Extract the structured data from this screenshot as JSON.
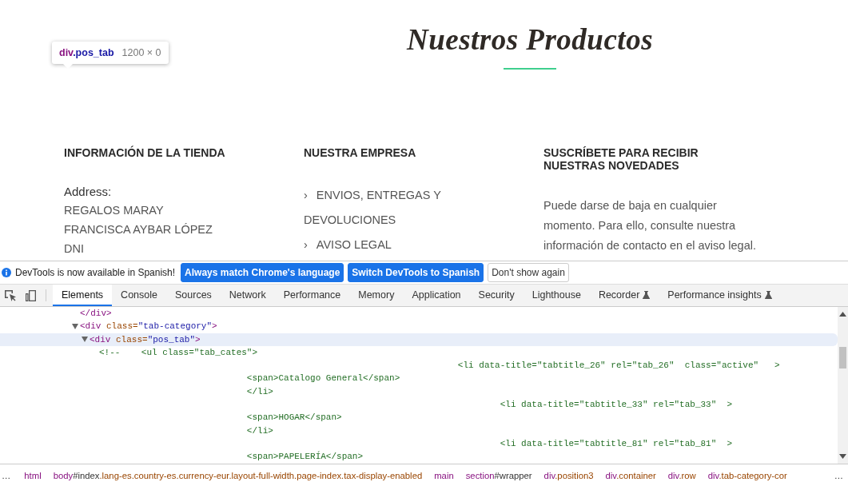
{
  "page": {
    "title": "Nuestros Productos",
    "tooltip": {
      "tokens": [
        {
          "kind": "tag",
          "text": "div"
        },
        {
          "kind": "class",
          "text": ".pos_tab"
        }
      ],
      "size": "1200 × 0"
    },
    "columns": [
      {
        "kind": "info",
        "heading": "INFORMACIÓN DE LA TIENDA",
        "label": "Address:",
        "lines": [
          "REGALOS MARAY",
          "FRANCISCA AYBAR LÓPEZ",
          "DNI"
        ]
      },
      {
        "kind": "links",
        "heading": "NUESTRA EMPRESA",
        "links": [
          {
            "bullet": "›",
            "text": "ENVIOS, ENTREGAS Y DEVOLUCIONES"
          },
          {
            "bullet": "›",
            "text": "AVISO LEGAL"
          }
        ]
      },
      {
        "kind": "text",
        "heading": "SUSCRÍBETE PARA RECIBIR NUESTRAS NOVEDADES",
        "paragraph": "Puede darse de baja en cualquier momento. Para ello, consulte nuestra información de contacto en el aviso legal."
      }
    ]
  },
  "devtools": {
    "infobar": {
      "message": "DevTools is now available in Spanish!",
      "buttons": [
        {
          "label": "Always match Chrome's language",
          "primary": true
        },
        {
          "label": "Switch DevTools to Spanish",
          "primary": true
        },
        {
          "label": "Don't show again",
          "primary": false
        }
      ]
    },
    "tabs": [
      {
        "label": "Elements",
        "selected": true,
        "experimental": false
      },
      {
        "label": "Console",
        "selected": false,
        "experimental": false
      },
      {
        "label": "Sources",
        "selected": false,
        "experimental": false
      },
      {
        "label": "Network",
        "selected": false,
        "experimental": false
      },
      {
        "label": "Performance",
        "selected": false,
        "experimental": false
      },
      {
        "label": "Memory",
        "selected": false,
        "experimental": false
      },
      {
        "label": "Application",
        "selected": false,
        "experimental": false
      },
      {
        "label": "Security",
        "selected": false,
        "experimental": false
      },
      {
        "label": "Lighthouse",
        "selected": false,
        "experimental": false
      },
      {
        "label": "Recorder",
        "selected": false,
        "experimental": true
      },
      {
        "label": "Performance insights",
        "selected": false,
        "experimental": true
      }
    ],
    "dom_tree": [
      {
        "tokens": [
          {
            "kind": "tag",
            "text": "</div>"
          }
        ],
        "selected": false
      },
      {
        "tokens": [
          {
            "kind": "tag",
            "text": "<div"
          },
          {
            "kind": "attr",
            "text": " class="
          },
          {
            "kind": "value",
            "text": "\"tab-category\""
          },
          {
            "kind": "tag",
            "text": ">"
          }
        ],
        "selected": false,
        "expanded": true,
        "children": [
          {
            "tokens": [
              {
                "kind": "tag",
                "text": "<div"
              },
              {
                "kind": "attr",
                "text": " class="
              },
              {
                "kind": "value",
                "text": "\"pos_tab\""
              },
              {
                "kind": "tag",
                "text": ">"
              }
            ],
            "selected": true,
            "expanded": true,
            "children": [
              {
                "kind": "comment",
                "lines": [
                  "<!--    <ul class=\"tab_cates\">",
                  "                                                                    <li data-title=\"tabtitle_26\" rel=\"tab_26\"  class=\"active\"   >",
                  "                            <span>Catalogo General</span>",
                  "                            </li>",
                  "                                                                            <li data-title=\"tabtitle_33\" rel=\"tab_33\"  >",
                  "                            <span>HOGAR</span>",
                  "                            </li>",
                  "                                                                            <li data-title=\"tabtitle_81\" rel=\"tab_81\"  >",
                  "                            <span>PAPELERÍA</span>"
                ]
              }
            ]
          }
        ]
      }
    ],
    "breadcrumbs": {
      "scroll_left": "…",
      "scroll_right": "…",
      "items": [
        [
          {
            "kind": "tag",
            "text": "html"
          }
        ],
        [
          {
            "kind": "tag",
            "text": "body"
          },
          {
            "kind": "id",
            "text": "#index"
          },
          {
            "kind": "class",
            "text": ".lang-es.country-es.currency-eur.layout-full-width.page-index.tax-display-enabled"
          }
        ],
        [
          {
            "kind": "tag",
            "text": "main"
          }
        ],
        [
          {
            "kind": "tag",
            "text": "section"
          },
          {
            "kind": "id",
            "text": "#wrapper"
          }
        ],
        [
          {
            "kind": "tag",
            "text": "div"
          },
          {
            "kind": "class",
            "text": ".position3"
          }
        ],
        [
          {
            "kind": "tag",
            "text": "div"
          },
          {
            "kind": "class",
            "text": ".container"
          }
        ],
        [
          {
            "kind": "tag",
            "text": "div"
          },
          {
            "kind": "class",
            "text": ".row"
          }
        ],
        [
          {
            "kind": "tag",
            "text": "div"
          },
          {
            "kind": "class",
            "text": ".tab-category-cor"
          }
        ]
      ]
    }
  }
}
